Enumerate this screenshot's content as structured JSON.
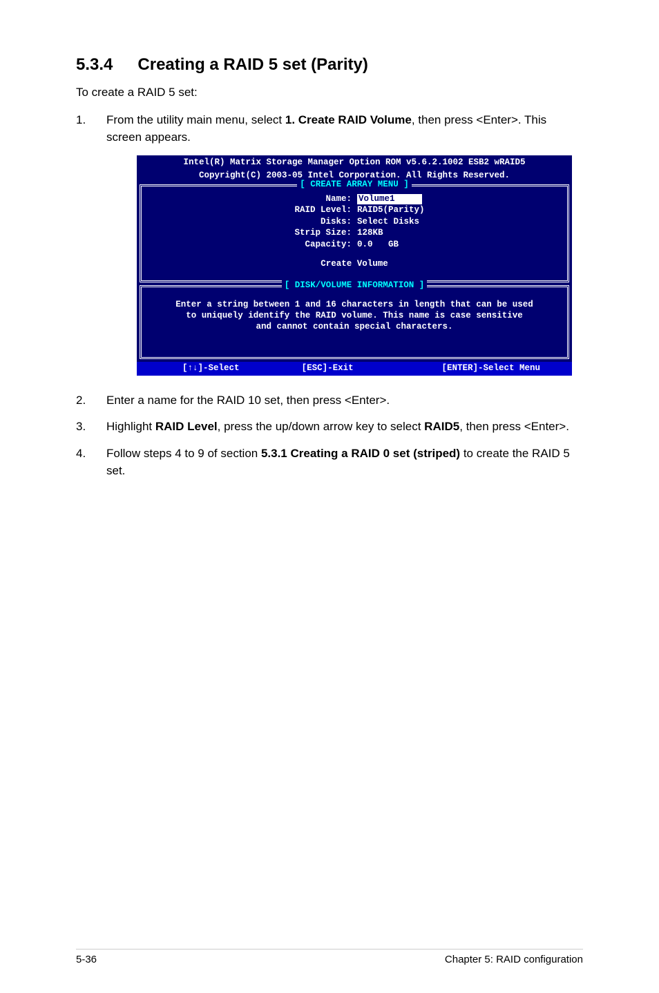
{
  "heading": {
    "number": "5.3.4",
    "title": "Creating a RAID 5 set (Parity)"
  },
  "intro": "To create a RAID 5 set:",
  "step1": {
    "n": "1.",
    "pre": "From the utility main menu, select ",
    "bold": "1. Create RAID Volume",
    "post": ", then press <Enter>. This screen appears."
  },
  "bios": {
    "header1": "Intel(R) Matrix Storage Manager Option ROM v5.6.2.1002 ESB2 wRAID5",
    "header2": "Copyright(C) 2003-05 Intel Corporation. All Rights Reserved.",
    "createTitle": "[ CREATE ARRAY MENU ]",
    "fields": {
      "nameLabel": "Name:",
      "nameValue": "Volume1",
      "raidLabel": "RAID Level:",
      "raidValue": "RAID5(Parity)",
      "disksLabel": "Disks:",
      "disksValue": "Select Disks",
      "stripLabel": "Strip Size:",
      "stripValue": "128KB",
      "capacityLabel": "Capacity:",
      "capacityValue": "0.0   GB"
    },
    "createAction": "Create Volume",
    "infoTitle": "[ DISK/VOLUME INFORMATION ]",
    "infoLine1": "Enter a string between 1 and 16 characters in length that can be used",
    "infoLine2": "to uniquely identify the RAID volume. This name is case sensitive",
    "infoLine3": "and cannot contain special characters.",
    "footerLeft": "[↑↓]-Select",
    "footerMid": "[ESC]-Exit",
    "footerRight": "[ENTER]-Select Menu"
  },
  "step2": {
    "n": "2.",
    "text": "Enter a name for the RAID 10 set, then press <Enter>."
  },
  "step3": {
    "n": "3.",
    "pre": "Highlight ",
    "b1": "RAID Level",
    "mid": ", press the up/down arrow key to select ",
    "b2": "RAID5",
    "post": ", then press <Enter>."
  },
  "step4": {
    "n": "4.",
    "pre": "Follow steps 4 to 9 of section ",
    "b": "5.3.1 Creating a RAID 0 set (striped)",
    "post": " to create the RAID 5 set."
  },
  "footer": {
    "left": "5-36",
    "right": "Chapter 5: RAID configuration"
  }
}
